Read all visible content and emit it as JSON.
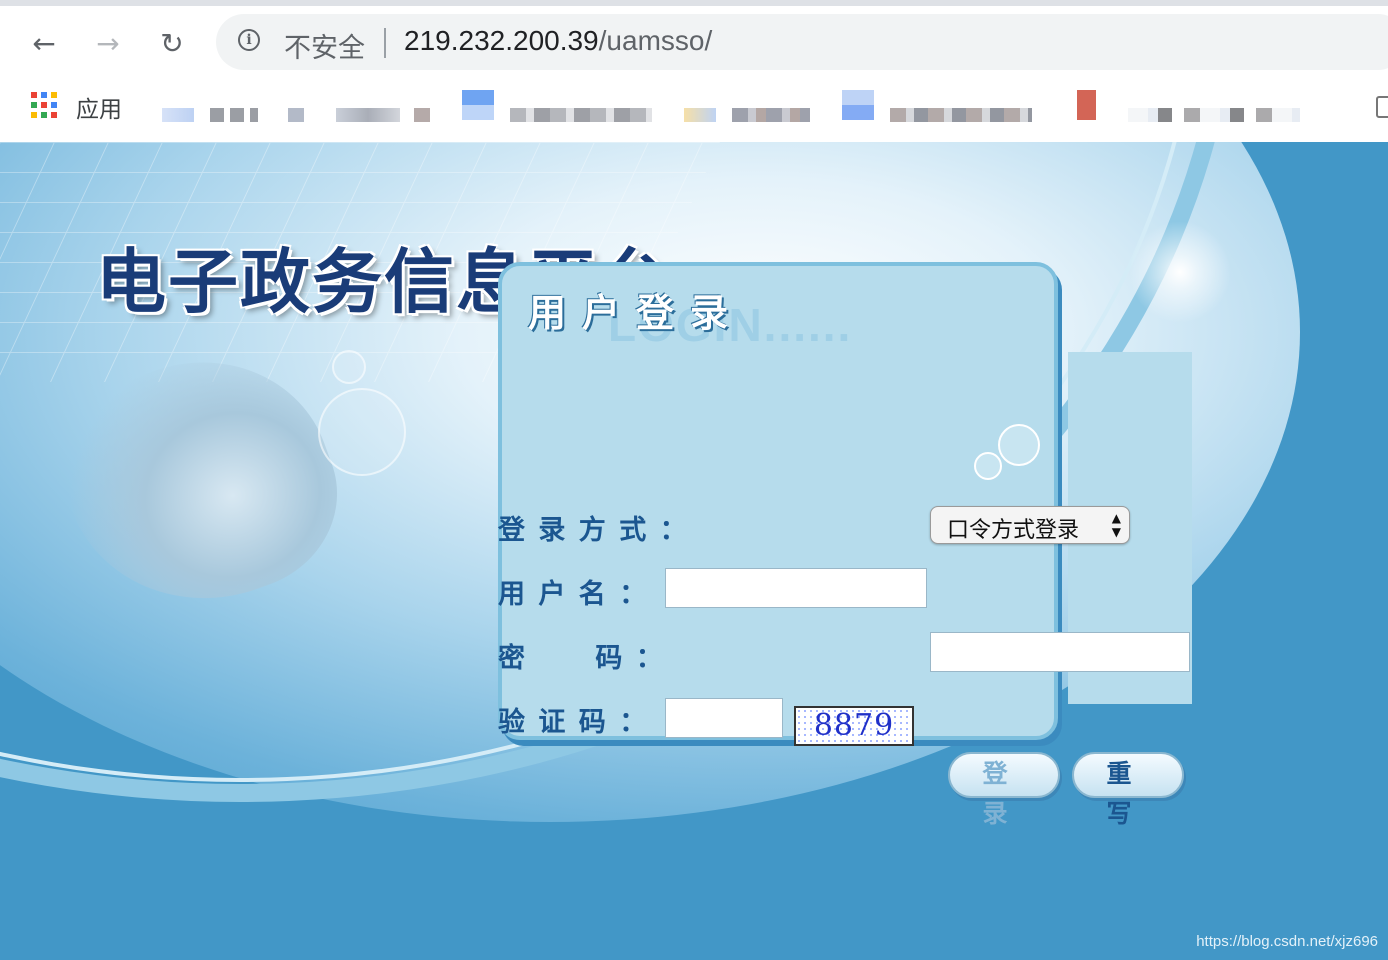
{
  "browser": {
    "security_text": "不安全",
    "url_host": "219.232.200.39",
    "url_path": "/uamsso/",
    "bookmarks": {
      "apps_label": "应用"
    }
  },
  "page": {
    "portal_title": "电子政务信息平台",
    "login": {
      "panel_title": "用户登录",
      "panel_subtitle": "LOGIN......",
      "method_label": "登 录 方 式 ：",
      "method_selected": "口令方式登录",
      "username_label": "用 户 名 ：",
      "username_value": "",
      "password_label": "密      码 ：",
      "password_value": "",
      "captcha_label": "验 证 码 ：",
      "captcha_input_value": "",
      "captcha_image_text": "8879",
      "login_button": "登 录",
      "reset_button": "重 写"
    },
    "watermark": "https://blog.csdn.net/xjz696"
  },
  "colors": {
    "page_background": "#4297c7",
    "panel_background": "#b6dcec",
    "title_blue": "#1a3c78",
    "label_blue": "#1b5690",
    "captcha_text": "#2030c8"
  },
  "icons": {
    "back": "arrow-left-icon",
    "forward": "arrow-right-icon",
    "reload": "reload-icon",
    "site_info": "info-icon",
    "apps": "apps-grid-icon"
  }
}
